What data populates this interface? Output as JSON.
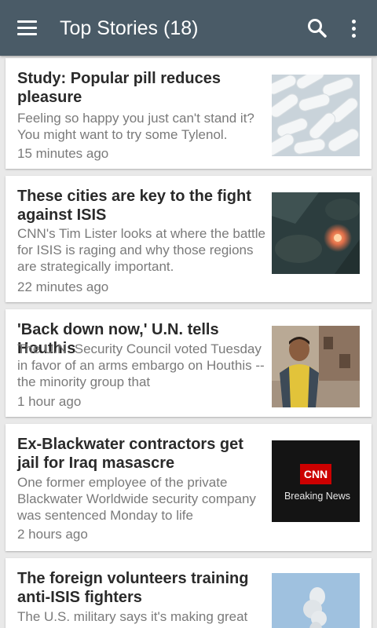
{
  "app_bar": {
    "title": "Top Stories (18)",
    "menu_icon": "hamburger-menu-icon",
    "search_icon": "search-icon",
    "overflow_icon": "overflow-menu-icon",
    "background_color": "#4a5b67"
  },
  "stories": [
    {
      "headline": "Study: Popular pill reduces pleasure",
      "description": "Feeling so happy you just can't stand it? You might want to try some Tylenol.",
      "time": "15 minutes ago",
      "thumbnail": "pills-thumbnail"
    },
    {
      "headline": "These cities are key to the fight against ISIS",
      "description": "CNN's Tim Lister looks at where the battle for ISIS is raging and why those regions are strategically important.",
      "time": "22 minutes ago",
      "thumbnail": "explosion-aerial-thumbnail"
    },
    {
      "headline": "'Back down now,' U.N. tells Houthis",
      "description": "The U.N. Security Council voted Tuesday in favor of an arms embargo on Houthis -- the minority group that",
      "time": "1 hour ago",
      "thumbnail": "boy-ruins-thumbnail"
    },
    {
      "headline": "Ex-Blackwater contractors get jail for Iraq masascre",
      "description": "One former employee of the private Blackwater Worldwide security company was sentenced Monday to life",
      "time": "2 hours ago",
      "thumbnail": "cnn-breaking-news-thumbnail",
      "thumbnail_text": {
        "logo": "CNN",
        "caption": "Breaking News"
      }
    },
    {
      "headline": "The foreign volunteers training anti-ISIS fighters",
      "description": "The U.S. military says it's making great",
      "time": "",
      "thumbnail": "smoke-plume-thumbnail"
    }
  ]
}
